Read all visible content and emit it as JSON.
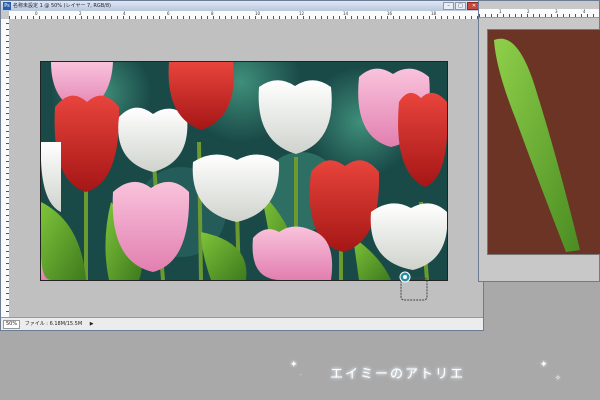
{
  "main_window": {
    "title": "名称未設定 1 @ 50% (レイヤー 7, RGB/8)",
    "app_icon": "Ps",
    "buttons": {
      "minimize": "–",
      "maximize": "□",
      "close": "✕"
    },
    "ruler_marks": [
      "0",
      "2",
      "4",
      "6",
      "8",
      "10",
      "12",
      "14",
      "16",
      "18"
    ],
    "status": {
      "zoom": "50%",
      "file_info": "ファイル : 6.18M/15.5M"
    }
  },
  "side_window": {
    "ruler_marks": [
      "1",
      "2",
      "3",
      "4"
    ]
  },
  "watermark": {
    "text": "エイミーのアトリエ"
  },
  "colors": {
    "workspace": "#a9a9a9",
    "canvas_bg": "#c0c0c0",
    "art_bg": "#1a4a48",
    "side_canvas": "#6b3424",
    "tulip_red": "#d62b2b",
    "tulip_pink": "#f2a6c8",
    "tulip_white": "#f1f1ee",
    "leaf_green": "#5f9e2a"
  }
}
